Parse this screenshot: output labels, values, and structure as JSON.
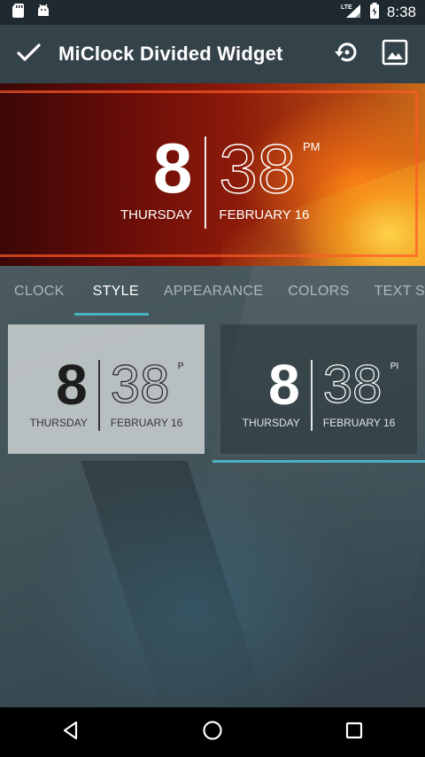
{
  "status_bar": {
    "time": "8:38",
    "network": "LTE",
    "icons": [
      "sd-card-icon",
      "android-icon",
      "signal-icon",
      "battery-icon"
    ]
  },
  "app_bar": {
    "title": "MiClock Divided Widget",
    "confirm_icon": "check-icon",
    "restore_icon": "restore-icon",
    "wallpaper_icon": "image-icon"
  },
  "preview": {
    "hour": "8",
    "minute": "38",
    "ampm": "PM",
    "day": "THURSDAY",
    "date": "FEBRUARY 16"
  },
  "tabs": [
    {
      "label": "CLOCK",
      "active": false
    },
    {
      "label": "STYLE",
      "active": true
    },
    {
      "label": "APPEARANCE",
      "active": false
    },
    {
      "label": "COLORS",
      "active": false
    },
    {
      "label": "TEXT STYLE",
      "active": false
    }
  ],
  "styles": [
    {
      "hour": "8",
      "minute": "38",
      "ampm": "P",
      "day": "THURSDAY",
      "date": "FEBRUARY 16",
      "theme": "light",
      "selected": false
    },
    {
      "hour": "8",
      "minute": "38",
      "ampm": "PI",
      "day": "THURSDAY",
      "date": "FEBRUARY 16",
      "theme": "dark",
      "selected": true
    }
  ],
  "colors": {
    "accent": "#49b2bf",
    "app_bar": "#344249",
    "status_bar": "#1f2a30"
  },
  "nav_bar": {
    "icons": [
      "back-icon",
      "home-icon",
      "recents-icon"
    ]
  }
}
